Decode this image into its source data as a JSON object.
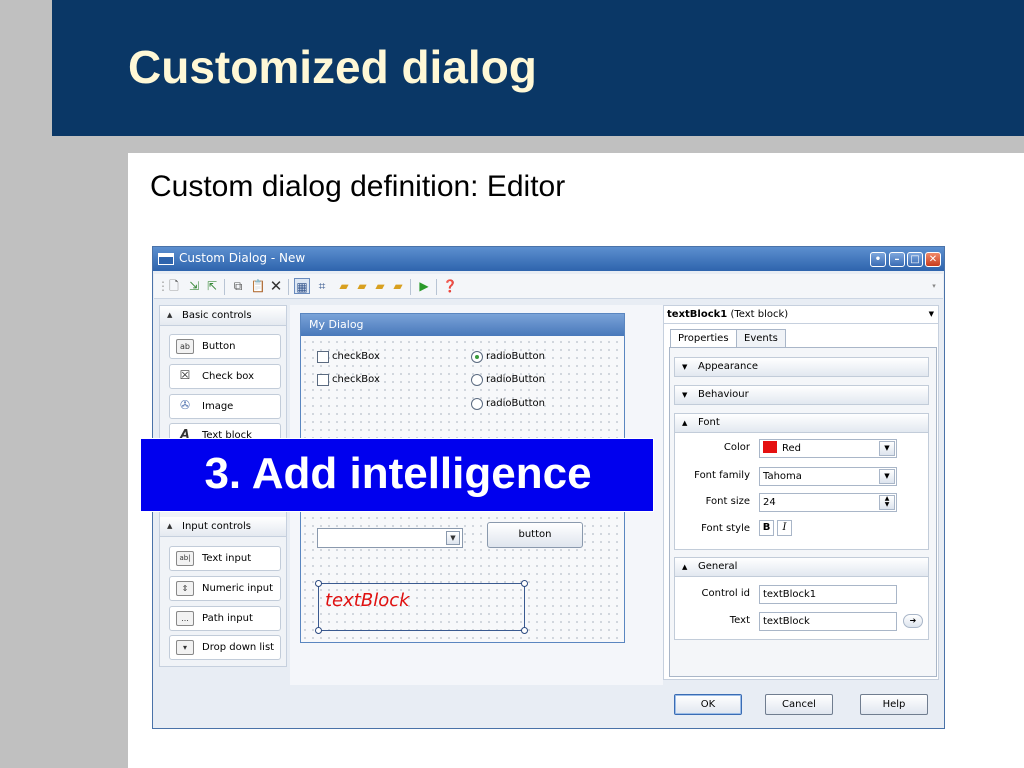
{
  "slide": {
    "title": "Customized dialog",
    "subtitle": "Custom dialog definition: Editor",
    "overlay": "3. Add intelligence"
  },
  "window": {
    "title": "Custom Dialog - New",
    "controls": [
      "help-icon",
      "minimize-icon",
      "maximize-icon",
      "close-icon"
    ]
  },
  "toolbar": {
    "icons": [
      "grip-icon",
      "new-document-icon",
      "import-icon",
      "export-icon",
      "copy-icon",
      "paste-icon",
      "delete-icon",
      "grid-icon",
      "align-icon",
      "bring-forward-icon",
      "send-backward-icon",
      "bring-to-front-icon",
      "send-to-back-icon",
      "run-icon",
      "help-icon"
    ]
  },
  "palette": {
    "basic": {
      "header": "Basic controls",
      "items": [
        {
          "label": "Button",
          "icon": "ab"
        },
        {
          "label": "Check box",
          "icon": "☒"
        },
        {
          "label": "Image",
          "icon": "✇"
        },
        {
          "label": "Text block",
          "icon": "A"
        }
      ]
    },
    "input": {
      "header": "Input controls",
      "items": [
        {
          "label": "Text input",
          "icon": "ab|"
        },
        {
          "label": "Numeric input",
          "icon": "⇕"
        },
        {
          "label": "Path input",
          "icon": "..."
        },
        {
          "label": "Drop down list",
          "icon": "▾"
        }
      ]
    }
  },
  "designer": {
    "dialog_title": "My Dialog",
    "checkbox_1": "checkBox",
    "checkbox_2": "checkBox",
    "radio_1": "radioButton",
    "radio_2": "radioButton",
    "radio_3": "radioButton",
    "button_label": "button",
    "textblock_text": "textBlock"
  },
  "properties": {
    "object_name": "textBlock1",
    "object_type": "(Text block)",
    "tabs": [
      "Properties",
      "Events"
    ],
    "sections": {
      "appearance": "Appearance",
      "behaviour": "Behaviour",
      "font": "Font",
      "general": "General"
    },
    "font": {
      "color_label": "Color",
      "color_value": "Red",
      "color_swatch": "#e51010",
      "family_label": "Font family",
      "family_value": "Tahoma",
      "size_label": "Font size",
      "size_value": "24",
      "style_label": "Font style",
      "bold": "B",
      "italic": "I"
    },
    "general": {
      "control_id_label": "Control id",
      "control_id_value": "textBlock1",
      "text_label": "Text",
      "text_value": "textBlock"
    }
  },
  "buttons": {
    "ok": "OK",
    "cancel": "Cancel",
    "help": "Help"
  },
  "colors": {
    "header_band": "#0a3766",
    "title_text": "#fff8d6",
    "overlay_bg": "#0000ee"
  }
}
